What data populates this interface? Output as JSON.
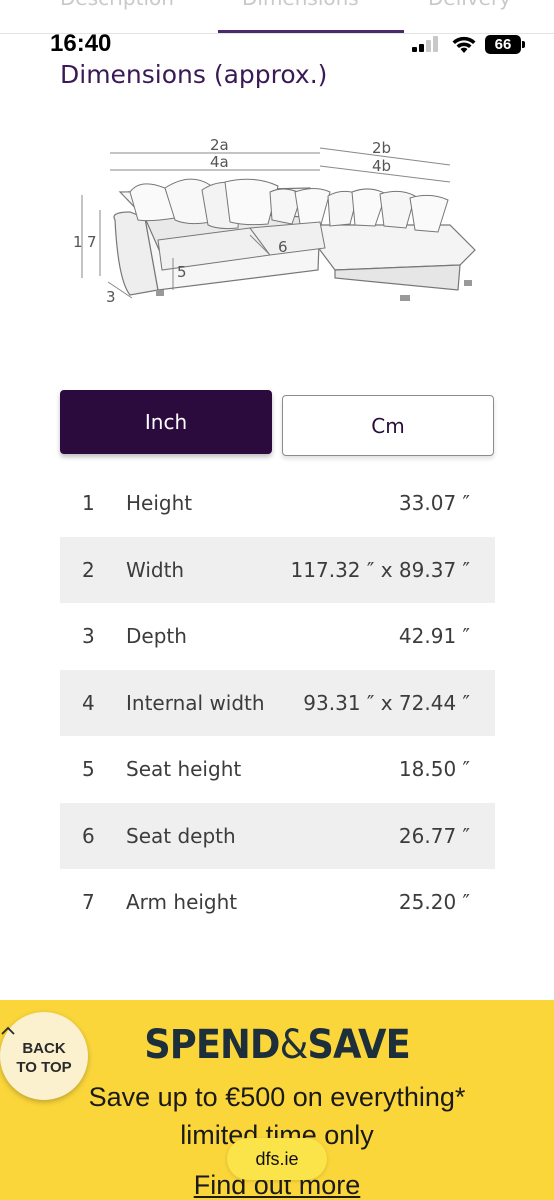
{
  "tabs": [
    {
      "label": "Description"
    },
    {
      "label": "Dimensions"
    },
    {
      "label": "Delivery"
    }
  ],
  "status_bar": {
    "time": "16:40",
    "battery": "66"
  },
  "section": {
    "title": "Dimensions (approx.)"
  },
  "diagram": {
    "labels": {
      "l2a": "2a",
      "l4a": "4a",
      "l2b": "2b",
      "l4b": "4b",
      "l1": "1",
      "l7": "7",
      "l6": "6",
      "l5": "5",
      "l3": "3"
    }
  },
  "unit_toggle": {
    "inch_label": "Inch",
    "cm_label": "Cm",
    "selected": "Inch"
  },
  "dimensions": [
    {
      "num": "1",
      "label": "Height",
      "value": "33.07 ″"
    },
    {
      "num": "2",
      "label": "Width",
      "value": "117.32 ″ x 89.37 ″"
    },
    {
      "num": "3",
      "label": "Depth",
      "value": "42.91 ″"
    },
    {
      "num": "4",
      "label": "Internal width",
      "value": "93.31 ″ x 72.44 ″"
    },
    {
      "num": "5",
      "label": "Seat height",
      "value": "18.50 ″"
    },
    {
      "num": "6",
      "label": "Seat depth",
      "value": "26.77 ″"
    },
    {
      "num": "7",
      "label": "Arm height",
      "value": "25.20 ″"
    }
  ],
  "promo": {
    "headline_part1": "SPEND",
    "headline_amp": "&",
    "headline_part2": "SAVE",
    "line1": "Save up to €500 on everything*",
    "line2": "limited time only",
    "link": "Find out more",
    "bg_color": "#fbd63a"
  },
  "back_to_top": {
    "line1": "BACK",
    "line2": "TO TOP"
  },
  "browser": {
    "url": "dfs.ie"
  }
}
